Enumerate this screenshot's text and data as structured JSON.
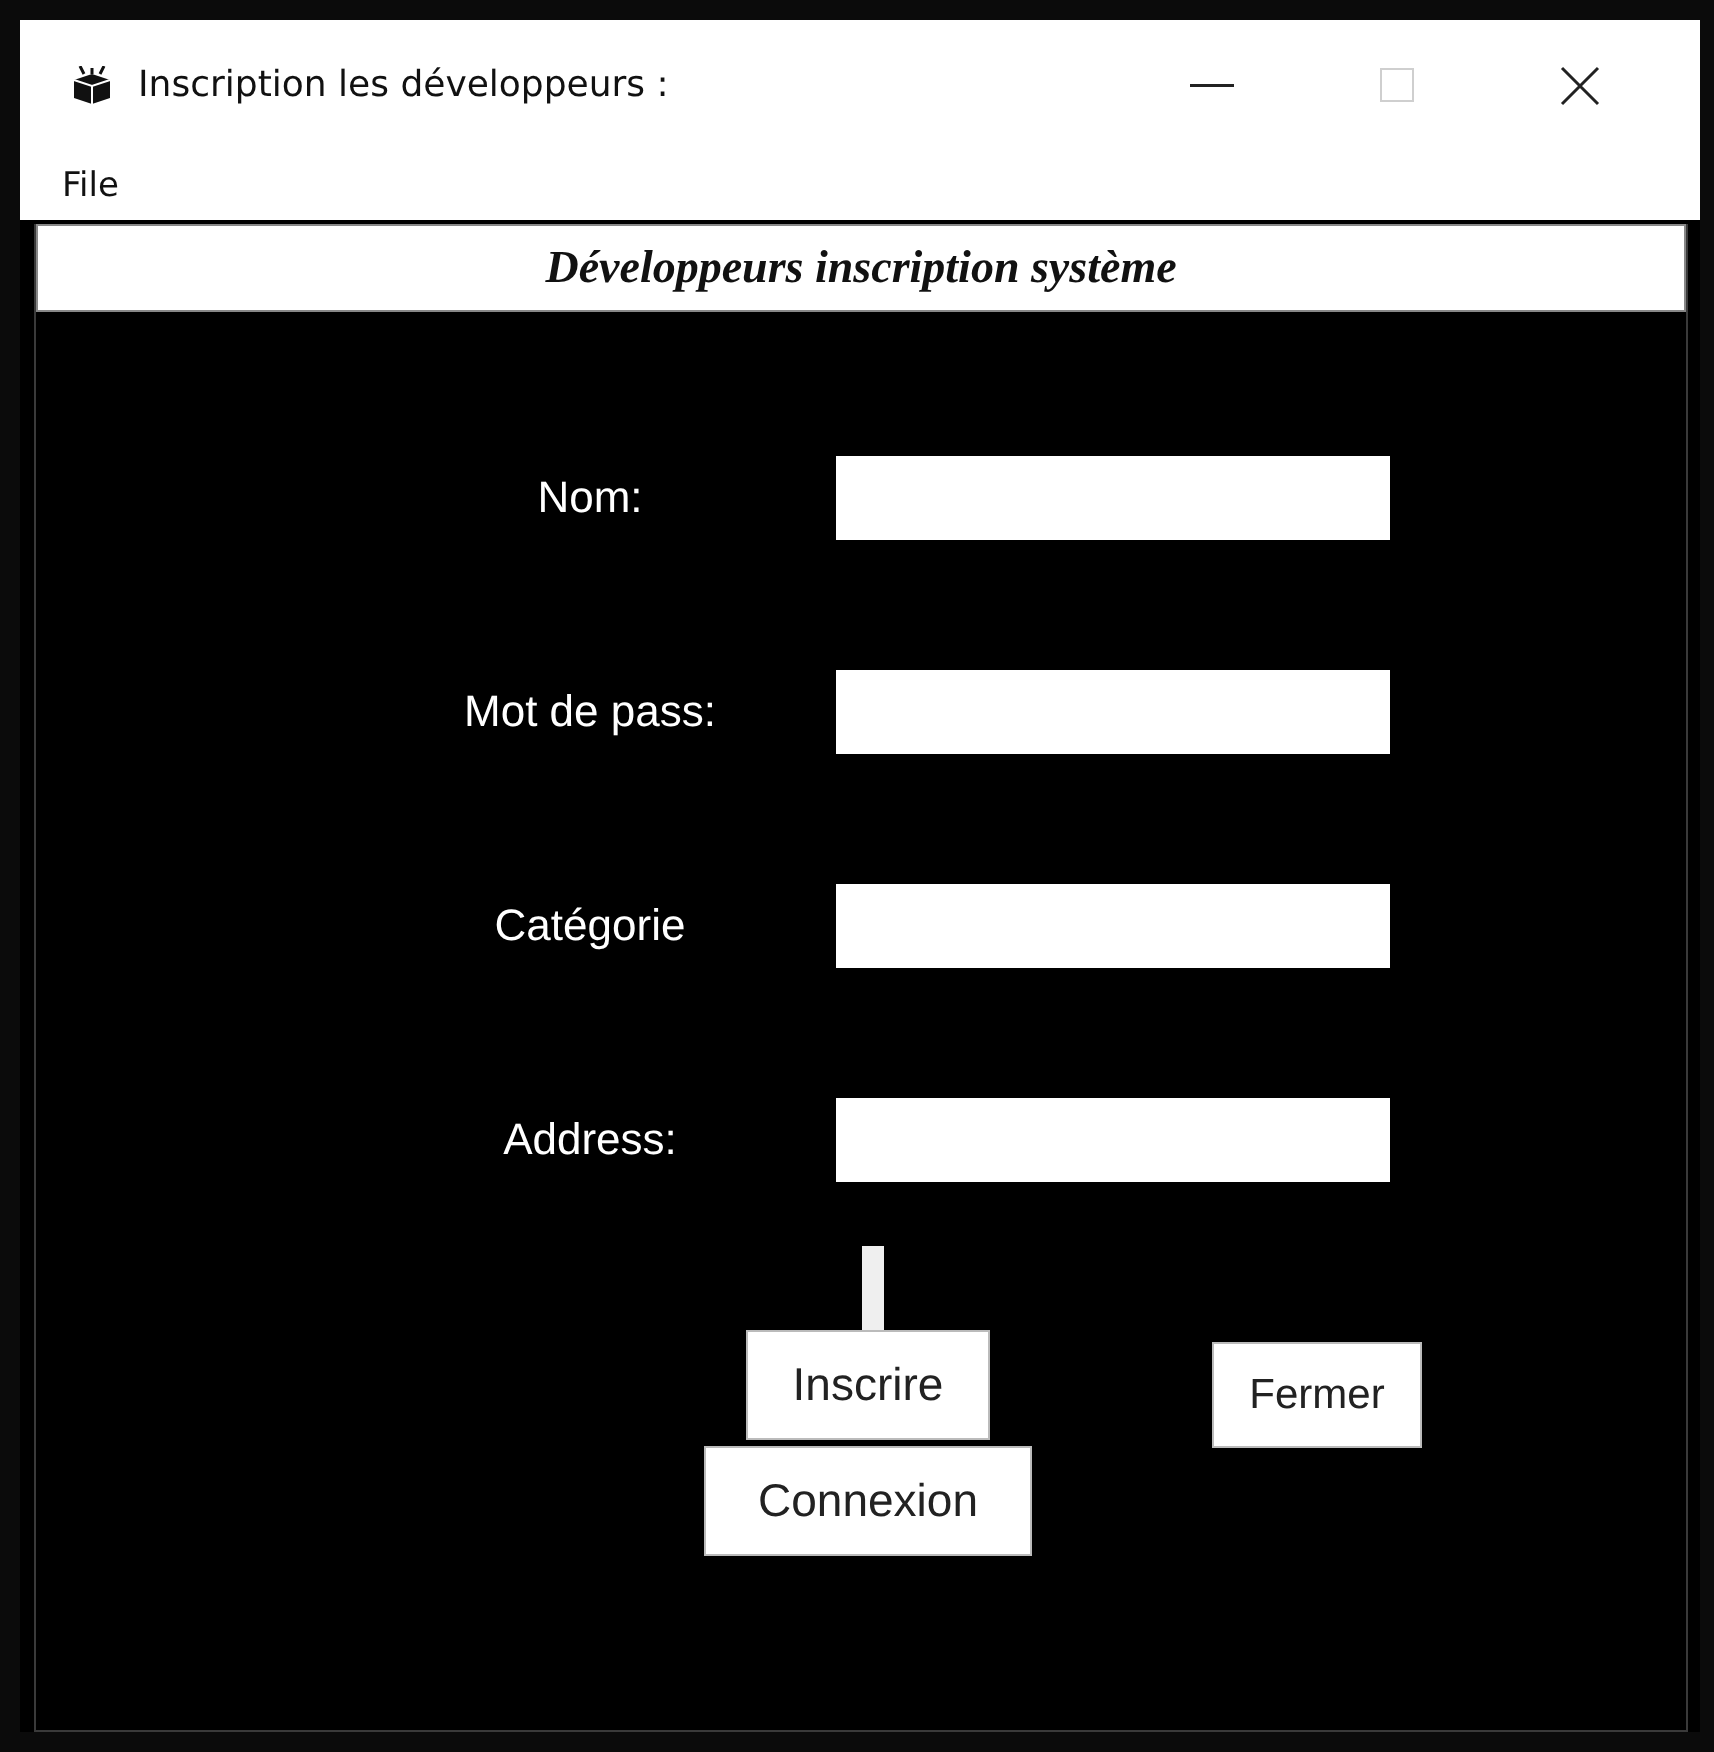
{
  "window": {
    "title": "Inscription les développeurs :",
    "controls": [
      {
        "kind": "minimize",
        "disabled": false
      },
      {
        "kind": "maximize",
        "disabled": true
      },
      {
        "kind": "close",
        "disabled": false
      }
    ]
  },
  "menu": [
    "File"
  ],
  "header": "Développeurs inscription système",
  "fields": [
    {
      "label": "Nom:"
    },
    {
      "label": "Mot de pass:"
    },
    {
      "label": "Catégorie"
    },
    {
      "label": "Address:"
    }
  ],
  "buttons": {
    "register": "Inscrire",
    "login": "Connexion",
    "close": "Fermer"
  }
}
